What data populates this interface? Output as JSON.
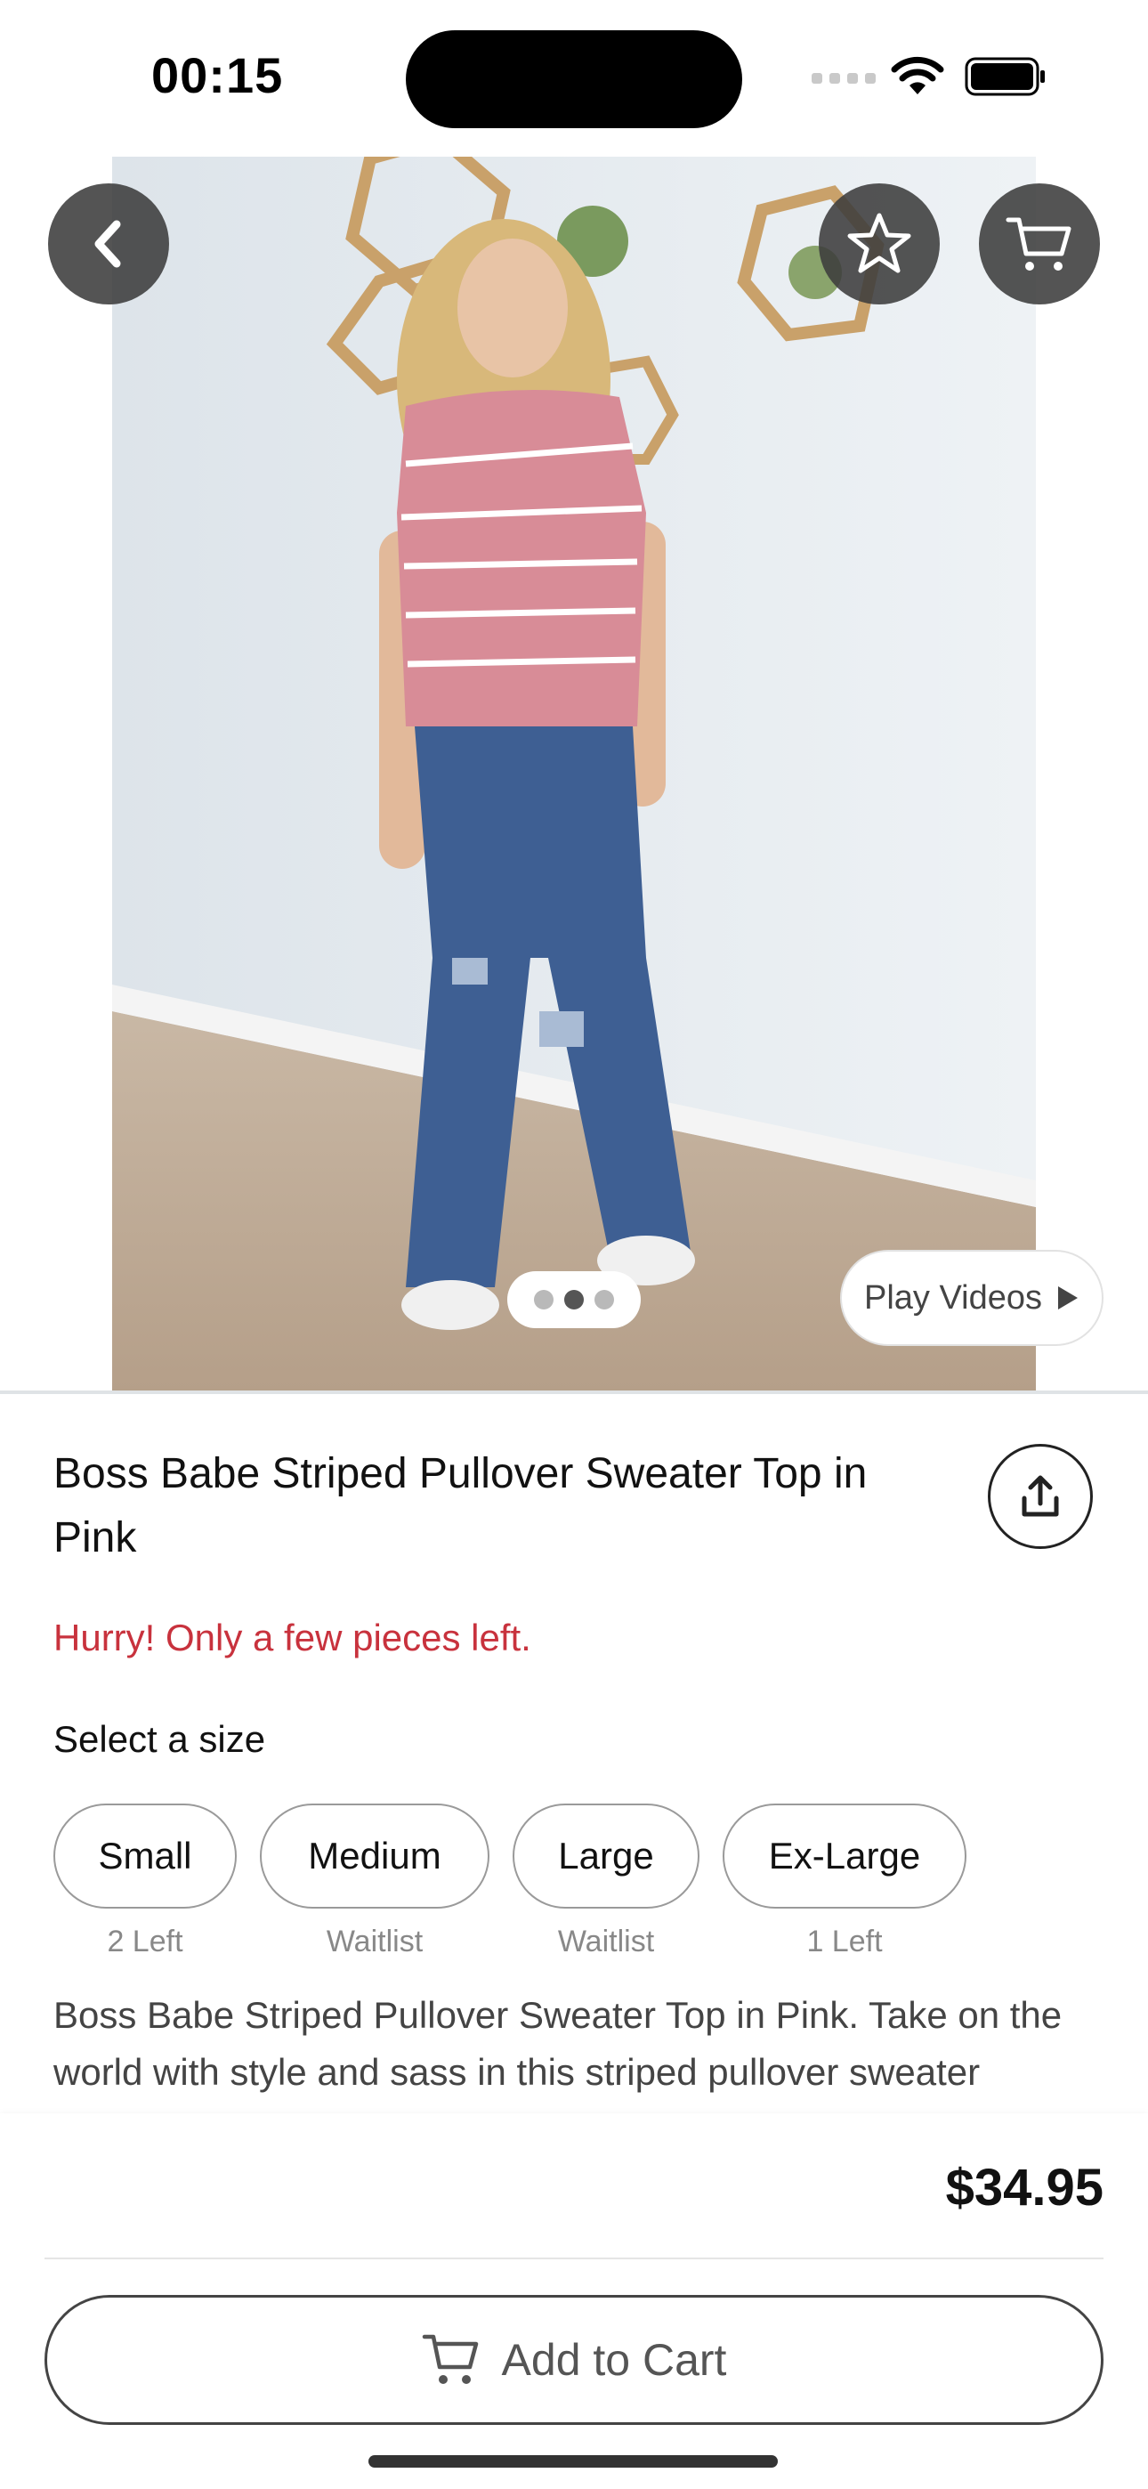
{
  "status_bar": {
    "time": "00:15"
  },
  "product": {
    "title": "Boss Babe Striped Pullover Sweater Top in Pink",
    "urgency": "Hurry! Only a few pieces left.",
    "size_label": "Select a size",
    "sizes": [
      {
        "label": "Small",
        "status": "2 Left"
      },
      {
        "label": "Medium",
        "status": "Waitlist"
      },
      {
        "label": "Large",
        "status": "Waitlist"
      },
      {
        "label": "Ex-Large",
        "status": "1 Left"
      }
    ],
    "description": "Boss Babe Striped Pullover Sweater Top in Pink. Take on the world with style and sass in this striped pullover sweater",
    "price": "$34.95"
  },
  "gallery": {
    "play_videos_label": "Play Videos",
    "image_count": 3,
    "active_index": 1
  },
  "actions": {
    "add_to_cart_label": "Add to Cart"
  },
  "icons": [
    "back-chevron-icon",
    "star-icon",
    "cart-icon",
    "share-icon",
    "play-icon",
    "wifi-icon",
    "battery-icon"
  ],
  "colors": {
    "urgency": "#c8323d",
    "button_overlay": "#3c3c3c"
  }
}
